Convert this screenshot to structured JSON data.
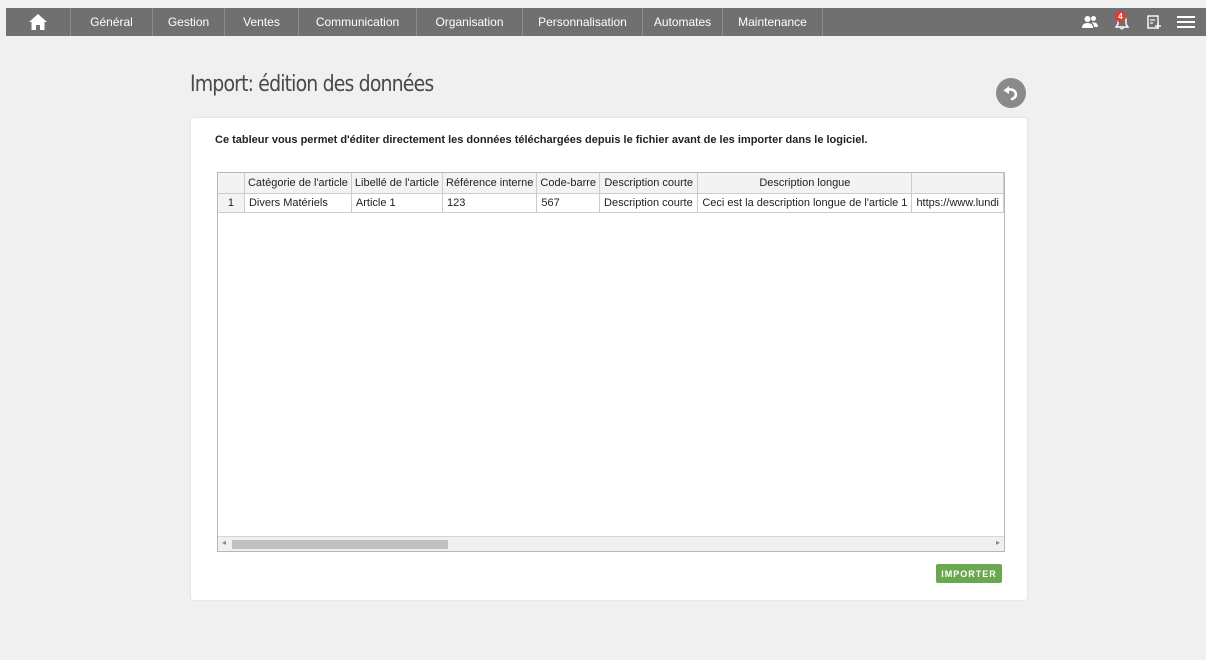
{
  "nav": {
    "home_icon": "home-icon",
    "items": [
      {
        "label": "Général"
      },
      {
        "label": "Gestion"
      },
      {
        "label": "Ventes"
      },
      {
        "label": "Communication"
      },
      {
        "label": "Organisation"
      },
      {
        "label": "Personnalisation"
      },
      {
        "label": "Automates"
      },
      {
        "label": "Maintenance"
      }
    ],
    "icons": {
      "users": "users-icon",
      "bell": "bell-icon",
      "notes": "notes-add-icon",
      "menu": "menu-icon"
    },
    "notification_count": "4"
  },
  "page": {
    "title": "Import: édition des données",
    "back_icon": "undo-icon"
  },
  "card": {
    "intro": "Ce tableur vous permet d'éditer directement les données téléchargées depuis le fichier avant de les importer dans le logiciel.",
    "import_label": "IMPORTER"
  },
  "sheet": {
    "headers": [
      "Catégorie de l'article",
      "Libellé de l'article",
      "Référence interne",
      "Code-barre",
      "Description courte",
      "Description longue",
      ""
    ],
    "rows": [
      {
        "num": "1",
        "cells": [
          "Divers Matériels",
          "Article 1",
          "123",
          "567",
          "Description courte",
          "Ceci est la description longue de l'article 1",
          "https://www.lundi"
        ]
      }
    ]
  },
  "colors": {
    "topbar": "#707070",
    "import_button": "#6aa84f",
    "badge": "#e53935"
  }
}
